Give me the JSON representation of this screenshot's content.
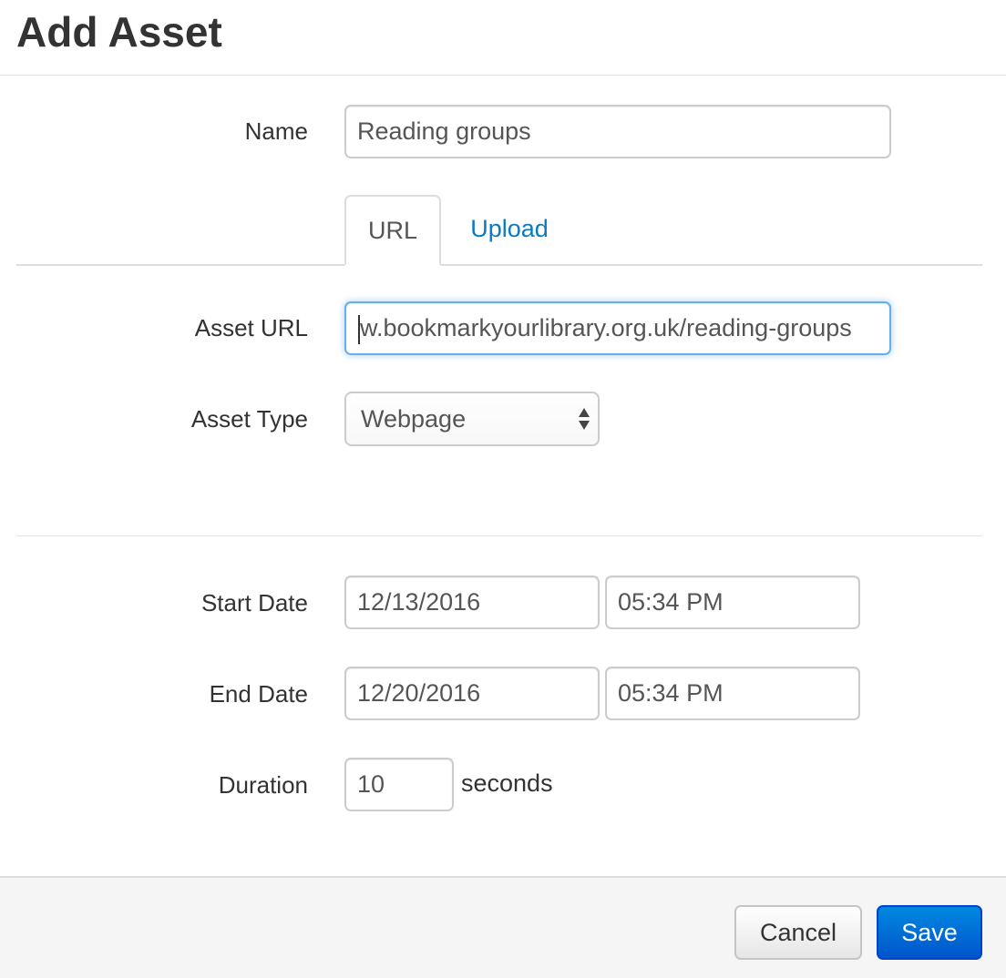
{
  "header": {
    "title": "Add Asset"
  },
  "form": {
    "name": {
      "label": "Name",
      "value": "Reading groups"
    },
    "tabs": [
      {
        "label": "URL",
        "active": true
      },
      {
        "label": "Upload",
        "active": false
      }
    ],
    "asset_url": {
      "label": "Asset URL",
      "value": "w.bookmarkyourlibrary.org.uk/reading-groups"
    },
    "asset_type": {
      "label": "Asset Type",
      "selected": "Webpage"
    },
    "start": {
      "label": "Start Date",
      "date": "12/13/2016",
      "time": "05:34 PM"
    },
    "end": {
      "label": "End Date",
      "date": "12/20/2016",
      "time": "05:34 PM"
    },
    "duration": {
      "label": "Duration",
      "value": "10",
      "unit": "seconds"
    }
  },
  "footer": {
    "cancel_label": "Cancel",
    "save_label": "Save"
  },
  "colors": {
    "link": "#0b7bc1",
    "primary": "#0066d6",
    "focus": "#66afe9"
  }
}
